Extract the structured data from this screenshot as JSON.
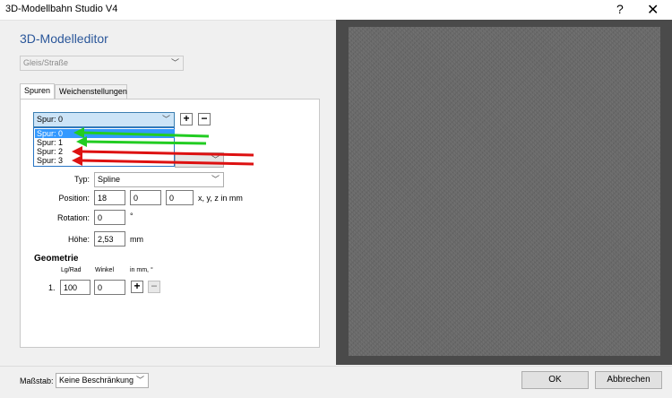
{
  "window": {
    "title": "3D-Modellbahn Studio V4",
    "help_glyph": "?",
    "close_glyph": "✕"
  },
  "editor": {
    "heading": "3D-Modelleditor",
    "type_select": "Gleis/Straße",
    "tabs": [
      "Spuren",
      "Weichenstellungen"
    ]
  },
  "track": {
    "selected": "Spur: 0",
    "add_label": "+",
    "remove_label": "−",
    "options": [
      "Spur: 0",
      "Spur: 1",
      "Spur: 2",
      "Spur: 3"
    ]
  },
  "annotations": {
    "arrow_colors": [
      "#22cc22",
      "#22cc22",
      "#dd1111",
      "#dd1111"
    ]
  },
  "form": {
    "typ_label": "Typ:",
    "typ_value": "Spline",
    "position_label": "Position:",
    "position_x": "18",
    "position_y": "0",
    "position_z": "0",
    "position_unit": "x, y, z in mm",
    "rotation_label": "Rotation:",
    "rotation_value": "0",
    "rotation_unit": "°",
    "height_label": "Höhe:",
    "height_value": "2,53",
    "height_unit": "mm"
  },
  "geometry": {
    "title": "Geometrie",
    "col_length": "Lg/Rad",
    "col_angle": "Winkel",
    "col_unit": "in mm, °",
    "rows": [
      {
        "index": "1.",
        "length": "100",
        "angle": "0",
        "add": "+",
        "remove": "−"
      }
    ]
  },
  "footer": {
    "scale_label": "Maßstab:",
    "scale_value": "Keine Beschränkung",
    "ok_label": "OK",
    "cancel_label": "Abbrechen"
  }
}
